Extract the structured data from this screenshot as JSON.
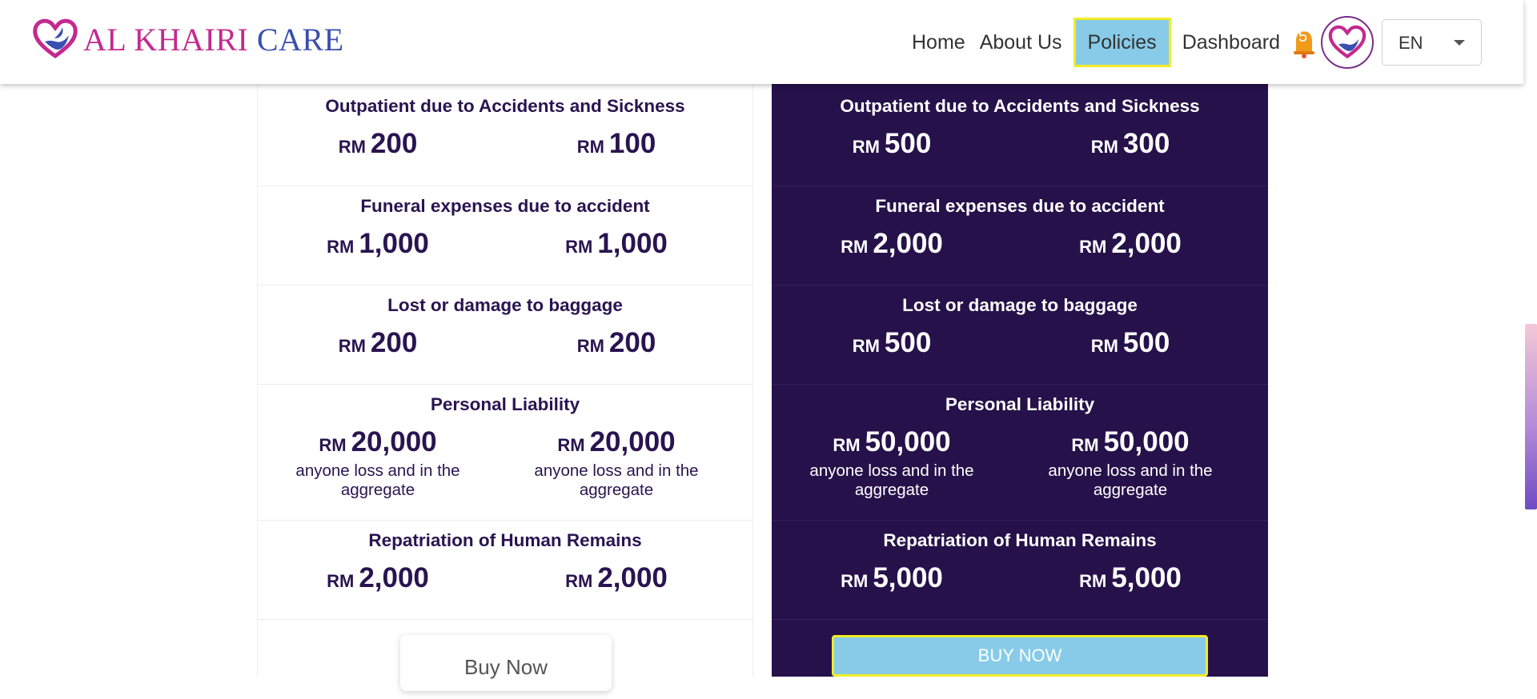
{
  "brand": {
    "logo_part1": "AL KHAIRI",
    "logo_part2": "CARE"
  },
  "nav": {
    "home": "Home",
    "about": "About Us",
    "policies": "Policies",
    "dashboard": "Dashboard",
    "notification_count": "5",
    "language": "EN"
  },
  "colors": {
    "accent_dark": "#26114a",
    "highlight_blue": "#87cbe8",
    "highlight_border": "#f1ec27",
    "logo_pink": "#c32a8f",
    "logo_blue": "#3b4fb0"
  },
  "currency": "RM",
  "plans": [
    {
      "theme": "light",
      "benefits": [
        {
          "title": "Outpatient due to Accidents and Sickness",
          "a": "200",
          "b": "100"
        },
        {
          "title": "Funeral expenses due to accident",
          "a": "1,000",
          "b": "1,000"
        },
        {
          "title": "Lost or damage to baggage",
          "a": "200",
          "b": "200"
        },
        {
          "title": "Personal Liability",
          "a": "20,000",
          "b": "20,000",
          "note_line1": "anyone loss and in the",
          "note_line2": "aggregate"
        },
        {
          "title": "Repatriation of Human Remains",
          "a": "2,000",
          "b": "2,000"
        }
      ],
      "buy_label": "Buy Now"
    },
    {
      "theme": "dark",
      "benefits": [
        {
          "title": "Outpatient due to Accidents and Sickness",
          "a": "500",
          "b": "300"
        },
        {
          "title": "Funeral expenses due to accident",
          "a": "2,000",
          "b": "2,000"
        },
        {
          "title": "Lost or damage to baggage",
          "a": "500",
          "b": "500"
        },
        {
          "title": "Personal Liability",
          "a": "50,000",
          "b": "50,000",
          "note_line1": "anyone loss and in the",
          "note_line2": "aggregate"
        },
        {
          "title": "Repatriation of Human Remains",
          "a": "5,000",
          "b": "5,000"
        }
      ],
      "buy_label": "BUY NOW"
    }
  ]
}
